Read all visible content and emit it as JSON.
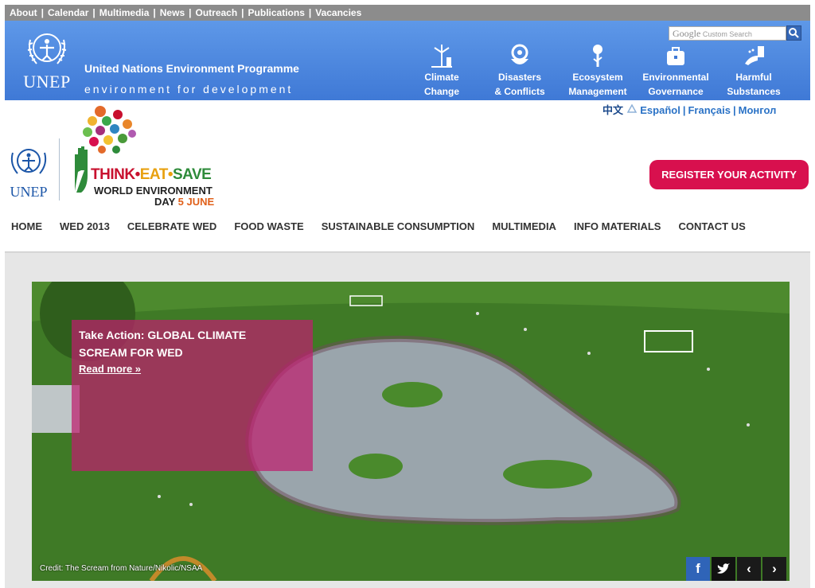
{
  "topnav": {
    "links": [
      "About",
      "Calendar",
      "Multimedia",
      "News",
      "Outreach",
      "Publications",
      "Vacancies"
    ],
    "separator": "|"
  },
  "unep_header": {
    "logo_text": "UNEP",
    "title": "United Nations Environment Programme",
    "subtitle": "environment for development",
    "search_brand": "Google",
    "search_placeholder": "Custom Search",
    "themes": [
      {
        "line1": "Climate",
        "line2": "Change",
        "icon": "wind-turbine-icon"
      },
      {
        "line1": "Disasters",
        "line2": "& Conflicts",
        "icon": "hands-icon"
      },
      {
        "line1": "Ecosystem",
        "line2": "Management",
        "icon": "tree-icon"
      },
      {
        "line1": "Environmental",
        "line2": "Governance",
        "icon": "briefcase-icon"
      },
      {
        "line1": "Harmful",
        "line2": "Substances",
        "icon": "hand-spray-icon"
      }
    ]
  },
  "languages": {
    "zh": "中文",
    "es": "Español",
    "fr": "Français",
    "mn": "Монгол",
    "separator": "|"
  },
  "wed": {
    "unep_logo_text": "UNEP",
    "title_think": "THINK",
    "title_eat": "EAT",
    "title_save": "SAVE",
    "dot": "•",
    "line2": "WORLD ENVIRONMENT",
    "line3_prefix": "DAY",
    "line3_date": "5 JUNE",
    "register_label": "REGISTER YOUR ACTIVITY"
  },
  "mainnav": [
    "HOME",
    "WED 2013",
    "CELEBRATE WED",
    "FOOD WASTE",
    "SUSTAINABLE CONSUMPTION",
    "MULTIMEDIA",
    "INFO MATERIALS",
    "CONTACT US"
  ],
  "hero": {
    "headline_line1": "Take Action: GLOBAL CLIMATE",
    "headline_line2": "SCREAM FOR WED",
    "read_more": "Read more »",
    "credit": "Credit: The Scream from Nature/Nikolic/NSAA",
    "controls": {
      "facebook": "f",
      "prev": "‹",
      "next": "›"
    }
  },
  "colors": {
    "top_gray": "#8c8c8c",
    "unep_blue": "#4a86e0",
    "register": "#d8104e",
    "overlay": "#be1e6e",
    "language_link": "#2a72c6"
  }
}
